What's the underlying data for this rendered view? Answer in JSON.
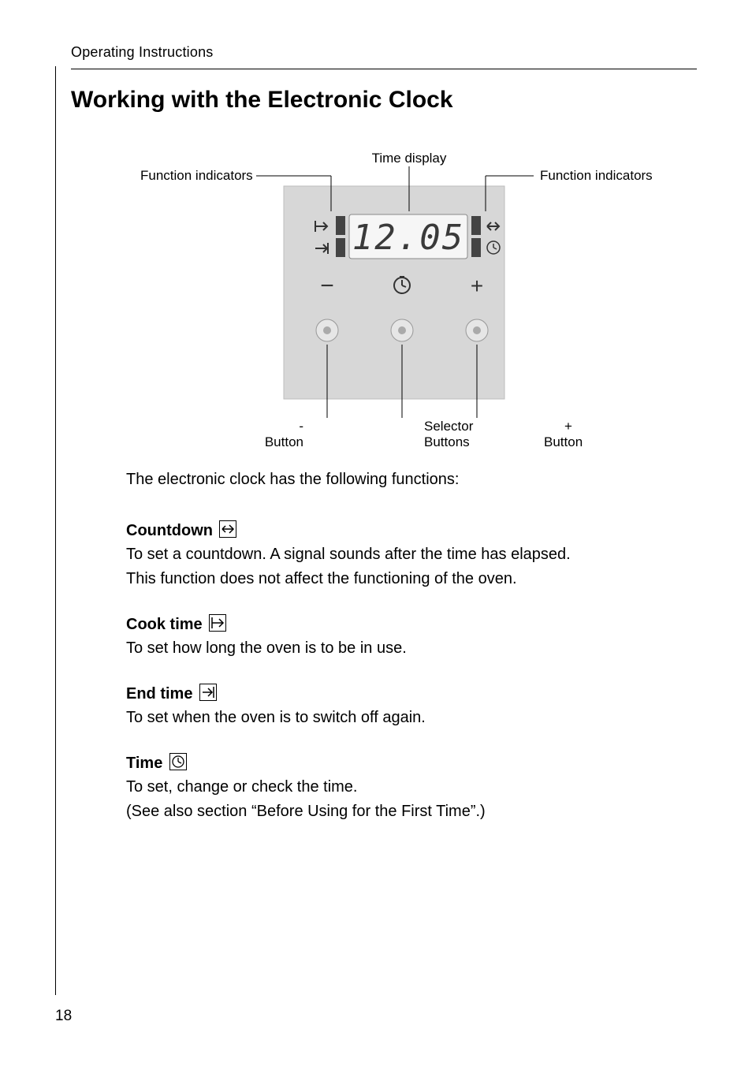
{
  "header": {
    "section": "Operating Instructions"
  },
  "title": "Working with the Electronic Clock",
  "diagram": {
    "labels": {
      "func_left": "Function indicators",
      "func_right": "Function indicators",
      "time_display": "Time display",
      "minus_button_top": "-",
      "minus_button_bot": "Button",
      "selector_top": "Selector",
      "selector_bot": "Buttons",
      "plus_button_top": "+",
      "plus_button_bot": "Button"
    },
    "time_value": "12.05",
    "minus_sym": "−",
    "plus_sym": "+"
  },
  "intro": "The electronic clock has the following functions:",
  "functions": {
    "countdown": {
      "title": "Countdown",
      "desc1": "To set a countdown. A signal sounds after the time has elapsed.",
      "desc2": "This function does not affect the functioning of the oven."
    },
    "cook": {
      "title": "Cook time",
      "desc": "To set how long the oven is to be in use."
    },
    "end": {
      "title": "End time",
      "desc": "To set when the oven is to switch off again."
    },
    "time": {
      "title": "Time",
      "desc1": "To set, change or check the time.",
      "desc2": "(See also section “Before Using for the First Time”.)"
    }
  },
  "page_number": "18"
}
